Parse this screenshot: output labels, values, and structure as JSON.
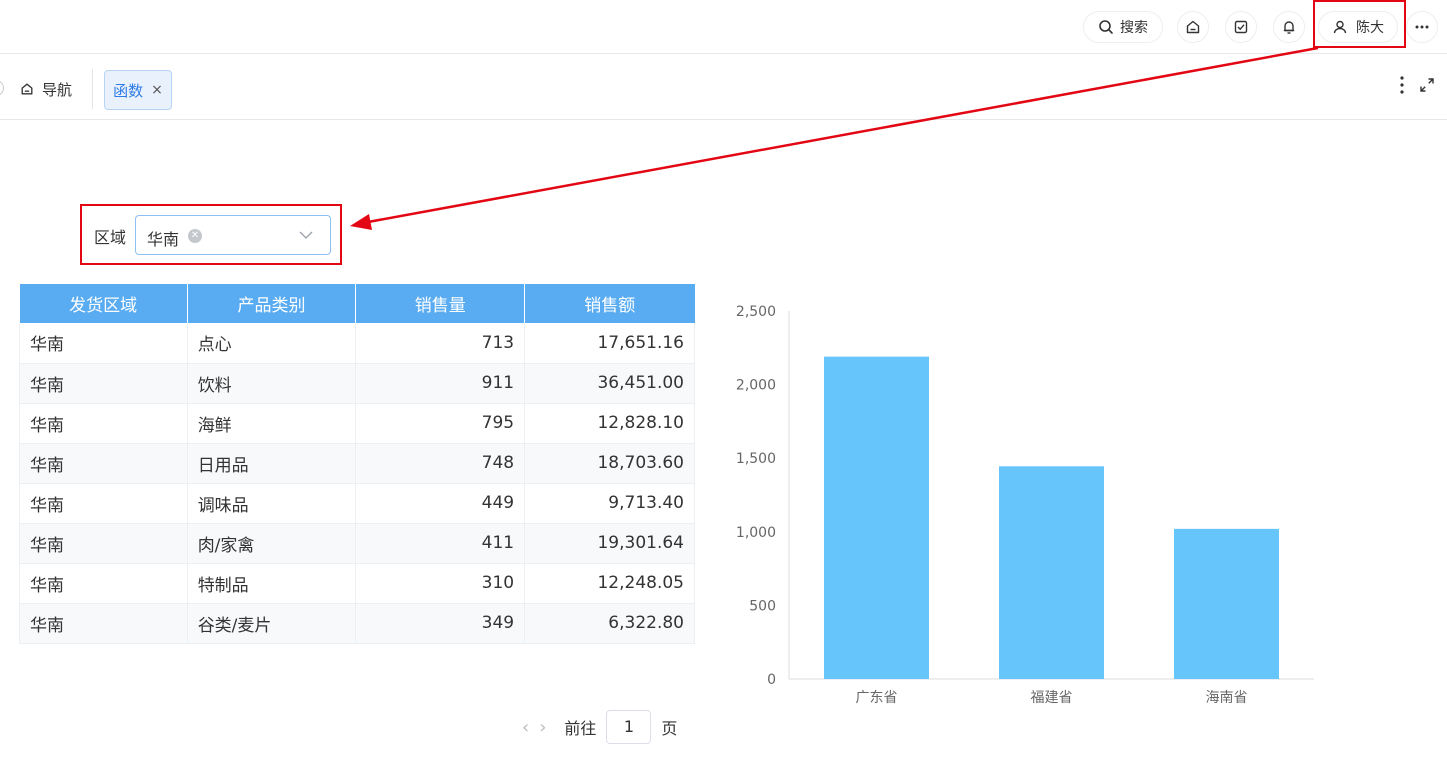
{
  "header": {
    "search_label": "搜索",
    "user_name": "陈大",
    "icons": [
      "search-icon",
      "home-icon",
      "task-check-icon",
      "bell-icon",
      "user-icon",
      "more-dots-icon"
    ]
  },
  "tabs": {
    "nav_label": "导航",
    "active_tab_label": "函数",
    "close_glyph": "×"
  },
  "filter": {
    "label": "区域",
    "value": "华南"
  },
  "table": {
    "headers": [
      "发货区域",
      "产品类别",
      "销售量",
      "销售额"
    ],
    "rows": [
      [
        "华南",
        "点心",
        "713",
        "17,651.16"
      ],
      [
        "华南",
        "饮料",
        "911",
        "36,451.00"
      ],
      [
        "华南",
        "海鲜",
        "795",
        "12,828.10"
      ],
      [
        "华南",
        "日用品",
        "748",
        "18,703.60"
      ],
      [
        "华南",
        "调味品",
        "449",
        "9,713.40"
      ],
      [
        "华南",
        "肉/家禽",
        "411",
        "19,301.64"
      ],
      [
        "华南",
        "特制品",
        "310",
        "12,248.05"
      ],
      [
        "华南",
        "谷类/麦片",
        "349",
        "6,322.80"
      ]
    ]
  },
  "pager": {
    "prefix": "前往",
    "page": "1",
    "suffix": "页"
  },
  "colors": {
    "accent": "#5aacf2",
    "bar": "#66c5fb",
    "annotation": "#e30613"
  },
  "chart_data": {
    "type": "bar",
    "categories": [
      "广东省",
      "福建省",
      "海南省"
    ],
    "values": [
      2190,
      1445,
      1020
    ],
    "ylim": [
      0,
      2500
    ],
    "yticks": [
      0,
      500,
      1000,
      1500,
      2000,
      2500
    ],
    "ytick_labels": [
      "0",
      "500",
      "1,000",
      "1,500",
      "2,000",
      "2,500"
    ],
    "title": "",
    "xlabel": "",
    "ylabel": "",
    "grid": false
  }
}
